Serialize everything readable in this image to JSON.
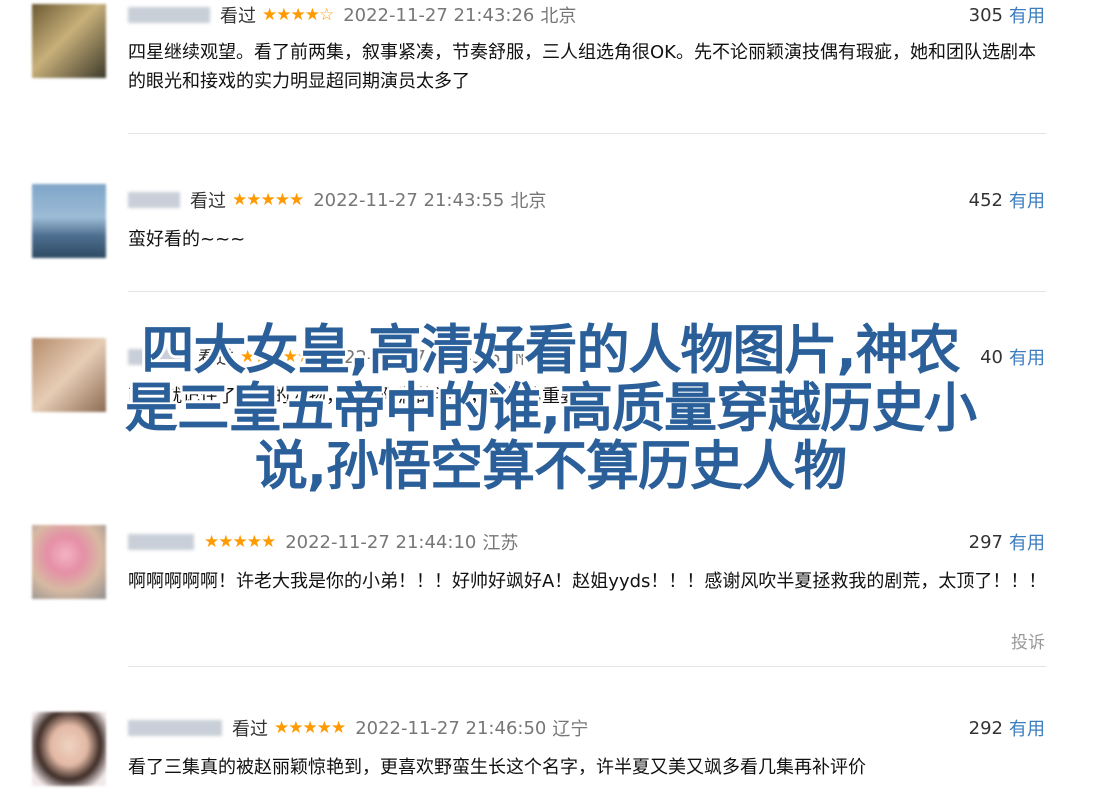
{
  "reviews": [
    {
      "seen": "看过",
      "stars": "★★★★☆",
      "time": "2022-11-27 21:43:26",
      "location": "北京",
      "count": "305",
      "useful": "有用",
      "content": "四星继续观望。看了前两集，叙事紧凑，节奏舒服，三人组选角很OK。先不论丽颖演技偶有瑕疵，她和团队选剧本的眼光和接戏的实力明显超同期演员太多了"
    },
    {
      "seen": "看过",
      "stars": "★★★★★",
      "time": "2022-11-27 21:43:55",
      "location": "北京",
      "count": "452",
      "useful": "有用",
      "content": "蛮好看的~~~"
    },
    {
      "seen": "看过",
      "stars": "★★★★★",
      "time": "2022-11-27 21:43:5",
      "location": "州",
      "count": "40",
      "useful": "有用",
      "content": "两集就记住了里面的人物，外表阳润的半夏，普懂的重要…"
    },
    {
      "seen": "",
      "stars": "★★★★★",
      "time": "2022-11-27 21:44:10",
      "location": "江苏",
      "count": "297",
      "useful": "有用",
      "content": "啊啊啊啊啊！许老大我是你的小弟！！！好帅好飒好A！赵姐yyds！！！感谢风吹半夏拯救我的剧荒，太顶了！！！",
      "report": "投诉"
    },
    {
      "seen": "看过",
      "stars": "★★★★★",
      "time": "2022-11-27 21:46:50",
      "location": "辽宁",
      "count": "292",
      "useful": "有用",
      "content": "看了三集真的被赵丽颖惊艳到，更喜欢野蛮生长这个名字，许半夏又美又飒多看几集再补评价"
    }
  ],
  "overlay": {
    "line1": "四大女皇,高清好看的人物图片,神农",
    "line2": "是三皇五帝中的谁,高质量穿越历史小",
    "line3": "说,孙悟空算不算历史人物"
  }
}
